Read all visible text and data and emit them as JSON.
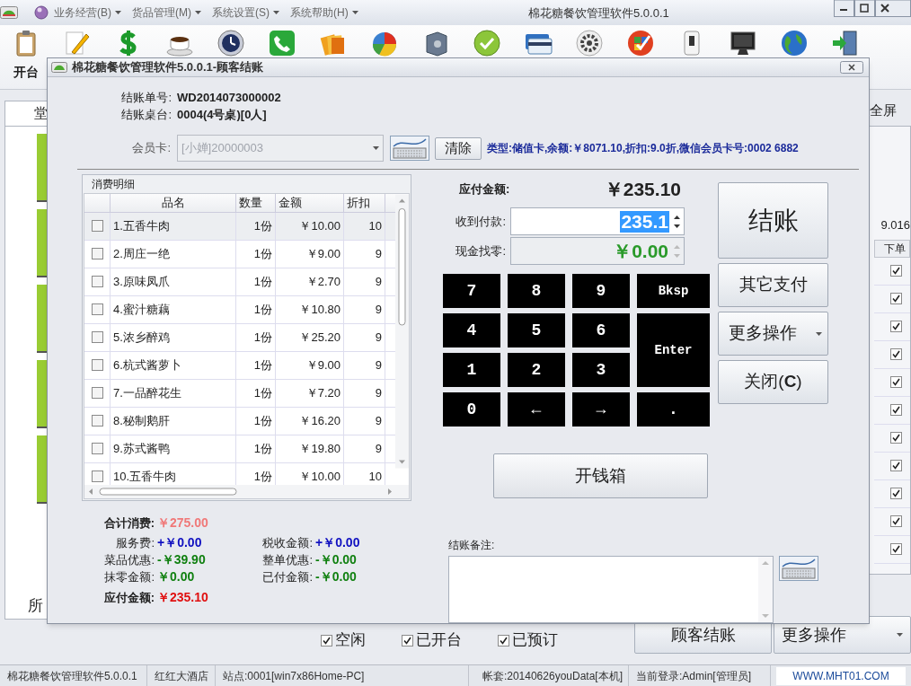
{
  "window": {
    "title": "棉花糖餐饮管理软件5.0.0.1"
  },
  "menu": [
    "业务经营(B)",
    "货品管理(M)",
    "系统设置(S)",
    "系统帮助(H)"
  ],
  "toolbar": [
    {
      "kind": "clipboard",
      "label": "开台"
    },
    {
      "kind": "pencil"
    },
    {
      "kind": "dollar"
    },
    {
      "kind": "coffee"
    },
    {
      "kind": "clock"
    },
    {
      "kind": "phone"
    },
    {
      "kind": "folders"
    },
    {
      "kind": "pie"
    },
    {
      "kind": "safe"
    },
    {
      "kind": "check"
    },
    {
      "kind": "card"
    },
    {
      "kind": "gear"
    },
    {
      "kind": "badge"
    },
    {
      "kind": "switch"
    },
    {
      "kind": "monitor"
    },
    {
      "kind": "globe"
    },
    {
      "kind": "exit"
    }
  ],
  "background": {
    "tab": "堂",
    "side_label": "所",
    "right_tab": "全屏",
    "right_value": "9.016",
    "right_column": "下单",
    "right_checks": [
      {
        "checked": true
      },
      {
        "checked": true
      },
      {
        "checked": true
      },
      {
        "checked": true
      },
      {
        "checked": true
      },
      {
        "checked": true
      },
      {
        "checked": true
      },
      {
        "checked": true
      },
      {
        "checked": true
      },
      {
        "checked": true
      },
      {
        "checked": true
      }
    ],
    "filters": [
      {
        "label": "空闲",
        "checked": true
      },
      {
        "label": "已开台",
        "checked": true
      },
      {
        "label": "已预订",
        "checked": true
      }
    ],
    "buttons": [
      "顾客结账",
      "更多操作"
    ]
  },
  "dialog": {
    "title": "棉花糖餐饮管理软件5.0.0.1-顾客结账",
    "info": [
      {
        "label": "结账单号:",
        "value": "WD2014073000002"
      },
      {
        "label": "结账桌台:",
        "value": "0004(4号桌)[0人]"
      }
    ],
    "member_card": {
      "label": "会员卡:",
      "value": "[小婵]20000003",
      "disabled": true
    },
    "clear_button": "清除",
    "member_info": "类型:储值卡,余额:￥8071.10,折扣:9.0折,微信会员卡号:0002 6882",
    "detail": {
      "title": "消费明细",
      "columns": [
        "品名",
        "数量",
        "金额",
        "折扣"
      ],
      "rows": [
        {
          "checked": false,
          "selected": true,
          "cells": [
            "1.五香牛肉",
            "1份",
            "￥10.00",
            "10"
          ]
        },
        {
          "checked": false,
          "selected": false,
          "cells": [
            "2.周庄一绝",
            "1份",
            "￥9.00",
            "9"
          ]
        },
        {
          "checked": false,
          "selected": false,
          "cells": [
            "3.原味凤爪",
            "1份",
            "￥2.70",
            "9"
          ]
        },
        {
          "checked": false,
          "selected": false,
          "cells": [
            "4.蜜汁糖藕",
            "1份",
            "￥10.80",
            "9"
          ]
        },
        {
          "checked": false,
          "selected": false,
          "cells": [
            "5.浓乡醉鸡",
            "1份",
            "￥25.20",
            "9"
          ]
        },
        {
          "checked": false,
          "selected": false,
          "cells": [
            "6.杭式酱萝卜",
            "1份",
            "￥9.00",
            "9"
          ]
        },
        {
          "checked": false,
          "selected": false,
          "cells": [
            "7.一品醉花生",
            "1份",
            "￥7.20",
            "9"
          ]
        },
        {
          "checked": false,
          "selected": false,
          "cells": [
            "8.秘制鹅肝",
            "1份",
            "￥16.20",
            "9"
          ]
        },
        {
          "checked": false,
          "selected": false,
          "cells": [
            "9.苏式酱鸭",
            "1份",
            "￥19.80",
            "9"
          ]
        },
        {
          "checked": false,
          "selected": false,
          "cells": [
            "10.五香牛肉",
            "1份",
            "￥10.00",
            "10"
          ]
        }
      ]
    },
    "amount_due": {
      "label": "应付金额:",
      "value": "￥235.10"
    },
    "received": {
      "label": "收到付款:",
      "value": "235.1",
      "selected": true
    },
    "change": {
      "label": "现金找零:",
      "value": "￥0.00"
    },
    "keypad": [
      {
        "key": "7",
        "kind": "key"
      },
      {
        "key": "8",
        "kind": "key"
      },
      {
        "key": "9",
        "kind": "key"
      },
      {
        "key": "Bksp",
        "kind": "key"
      },
      {
        "key": "4",
        "kind": "key"
      },
      {
        "key": "5",
        "kind": "key"
      },
      {
        "key": "6",
        "kind": "key"
      },
      {
        "key": "Enter",
        "kind": "tall"
      },
      {
        "key": "1",
        "kind": "key"
      },
      {
        "key": "2",
        "kind": "key"
      },
      {
        "key": "3",
        "kind": "key"
      },
      {
        "key": "0",
        "kind": "key"
      },
      {
        "key": "←",
        "kind": "key"
      },
      {
        "key": "→",
        "kind": "key"
      },
      {
        "key": ".",
        "kind": "key"
      }
    ],
    "actions": [
      {
        "label": "结账",
        "kind": "large"
      },
      {
        "label": "其它支付",
        "kind": "plain"
      },
      {
        "label": "更多操作",
        "kind": "dropdown"
      },
      {
        "label": "关闭(**C**)",
        "kind": "plain"
      }
    ],
    "cash_drawer": "开钱箱",
    "summary": [
      [
        {
          "label": "合计消费:",
          "value": "￥275.00",
          "color": "#f07878",
          "bold": true
        },
        {
          "label": "服务费:",
          "value": "+￥0.00",
          "color": "#1010c0",
          "bold": false
        },
        {
          "label": "菜品优惠:",
          "value": "-￥39.90",
          "color": "#108010",
          "bold": false
        },
        {
          "label": "抹零金额:",
          "value": "￥0.00",
          "color": "#108010",
          "bold": false
        },
        {
          "label": "应付金额:",
          "value": "￥235.10",
          "color": "#e01010",
          "bold": true
        }
      ],
      [
        {
          "label": "税收金额:",
          "value": "+￥0.00",
          "color": "#1010c0",
          "bold": false
        },
        {
          "label": "整单优惠:",
          "value": "-￥0.00",
          "color": "#108010",
          "bold": false
        },
        {
          "label": "已付金额:",
          "value": "-￥0.00",
          "color": "#108010",
          "bold": false
        }
      ]
    ],
    "remarks": {
      "label": "结账备注:"
    }
  },
  "status_bar": [
    "棉花糖餐饮管理软件5.0.0.1",
    "红红大酒店",
    "站点:0001[win7x86Home-PC]",
    "帐套:20140626youData[本机]",
    "当前登录:Admin[管理员]",
    "WWW.MHT01.COM"
  ]
}
